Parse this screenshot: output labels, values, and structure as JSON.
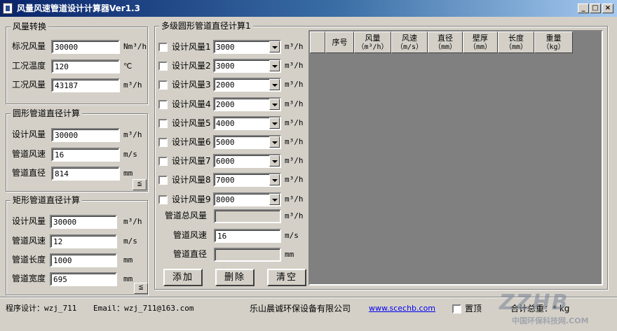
{
  "window": {
    "title": "风量风速管道设计计算器Ver1.3",
    "buttons": {
      "minimize": "_",
      "maximize": "□",
      "close": "×"
    }
  },
  "airflow_conversion": {
    "title": "风量转换",
    "rows": [
      {
        "label": "标况风量",
        "value": "30000",
        "unit": "Nm³/h"
      },
      {
        "label": "工况温度",
        "value": "120",
        "unit": "℃"
      },
      {
        "label": "工况风量",
        "value": "43187",
        "unit": "m³/h"
      }
    ]
  },
  "round_duct": {
    "title": "圆形管道直径计算",
    "rows": [
      {
        "label": "设计风量",
        "value": "30000",
        "unit": "m³/h"
      },
      {
        "label": "管道风速",
        "value": "16",
        "unit": "m/s"
      },
      {
        "label": "管道直径",
        "value": "814",
        "unit": "mm"
      }
    ],
    "calc_button": "≦"
  },
  "rect_duct": {
    "title": "矩形管道直径计算",
    "rows": [
      {
        "label": "设计风量",
        "value": "30000",
        "unit": "m³/h"
      },
      {
        "label": "管道风速",
        "value": "12",
        "unit": "m/s"
      },
      {
        "label": "管道长度",
        "value": "1000",
        "unit": "mm"
      },
      {
        "label": "管道宽度",
        "value": "695",
        "unit": "mm"
      }
    ],
    "calc_button": "≦"
  },
  "multi_duct": {
    "title": "多级圆形管道直径计算1",
    "rows": [
      {
        "label": "设计风量1",
        "value": "3000",
        "unit": "m³/h"
      },
      {
        "label": "设计风量2",
        "value": "3000",
        "unit": "m³/h"
      },
      {
        "label": "设计风量3",
        "value": "2000",
        "unit": "m³/h"
      },
      {
        "label": "设计风量4",
        "value": "2000",
        "unit": "m³/h"
      },
      {
        "label": "设计风量5",
        "value": "4000",
        "unit": "m³/h"
      },
      {
        "label": "设计风量6",
        "value": "5000",
        "unit": "m³/h"
      },
      {
        "label": "设计风量7",
        "value": "6000",
        "unit": "m³/h"
      },
      {
        "label": "设计风量8",
        "value": "7000",
        "unit": "m³/h"
      },
      {
        "label": "设计风量9",
        "value": "8000",
        "unit": "m³/h"
      }
    ],
    "total_flow": {
      "label": "管道总风量",
      "value": "",
      "unit": "m³/h"
    },
    "velocity": {
      "label": "管道风速",
      "value": "16",
      "unit": "m/s"
    },
    "diameter": {
      "label": "管道直径",
      "value": "",
      "unit": "mm"
    },
    "buttons": {
      "add": "添加",
      "delete": "删除",
      "clear": "清空"
    }
  },
  "grid": {
    "columns": [
      {
        "label": "",
        "sub": ""
      },
      {
        "label": "序号",
        "sub": ""
      },
      {
        "label": "风量",
        "sub": "（m³/h）"
      },
      {
        "label": "风速",
        "sub": "（m/s）"
      },
      {
        "label": "直径",
        "sub": "（mm）"
      },
      {
        "label": "壁厚",
        "sub": "（mm）"
      },
      {
        "label": "长度",
        "sub": "（mm）"
      },
      {
        "label": "重量",
        "sub": "（kg）"
      }
    ]
  },
  "status": {
    "designer": "程序设计：wzj_711",
    "email": "Email：wzj_711@163.com",
    "company": "乐山晨诚环保设备有限公司",
    "website": "www.scechb.com",
    "topmost_label": "置顶",
    "total_weight": "合计总重：* kg"
  },
  "watermark": {
    "logo": "ZZHB",
    "text": "中国环保科技网.COM"
  }
}
